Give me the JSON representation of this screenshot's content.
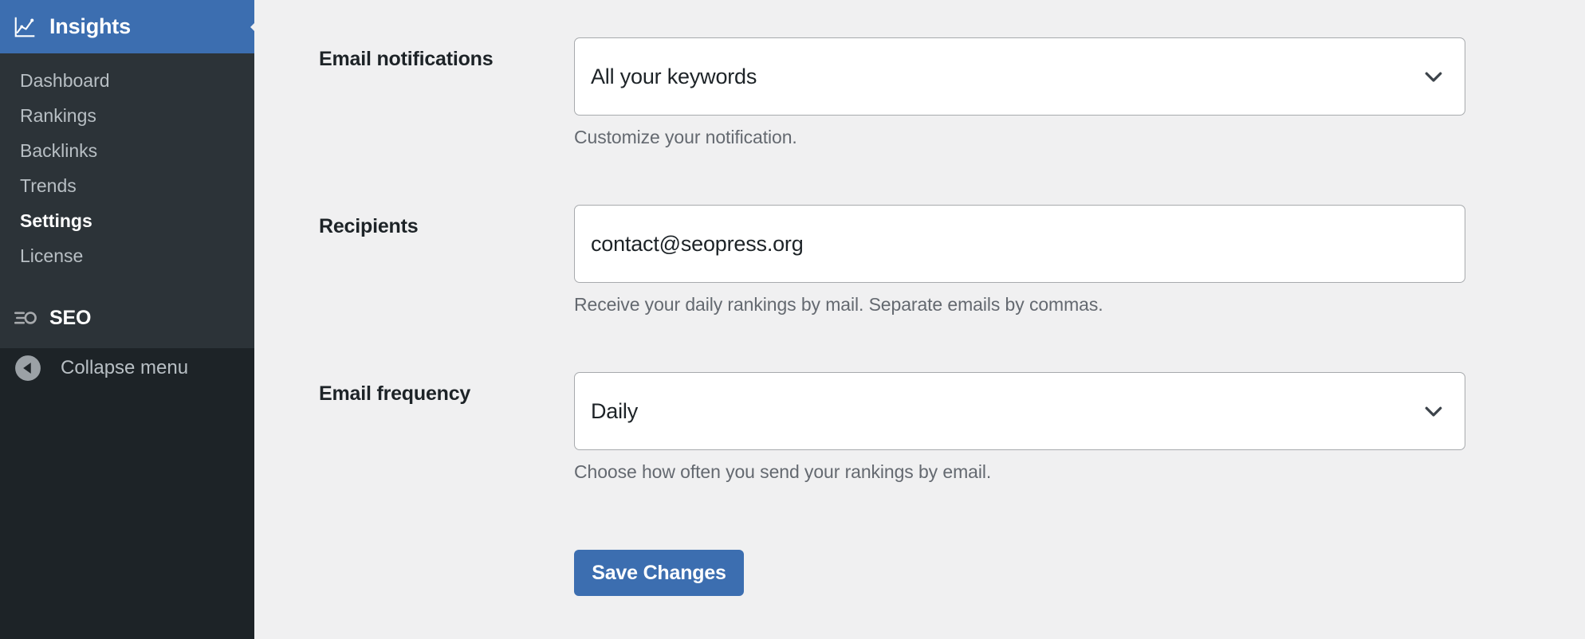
{
  "sidebar": {
    "header": {
      "label": "Insights",
      "icon": "chart-line-icon",
      "background_color": "#3c6eb0"
    },
    "items": [
      {
        "label": "Dashboard",
        "current": false
      },
      {
        "label": "Rankings",
        "current": false
      },
      {
        "label": "Backlinks",
        "current": false
      },
      {
        "label": "Trends",
        "current": false
      },
      {
        "label": "Settings",
        "current": true
      },
      {
        "label": "License",
        "current": false
      }
    ],
    "seo": {
      "label": "SEO",
      "icon": "seopress-logo-icon"
    },
    "collapse": {
      "label": "Collapse menu",
      "icon": "collapse-left-arrow-icon"
    },
    "colors": {
      "upper_background": "#2c3338",
      "lower_background": "#1d2327",
      "item_text": "#b8bfc4",
      "current_item_text": "#ffffff"
    }
  },
  "main": {
    "fields": [
      {
        "label": "Email notifications",
        "type": "select",
        "value": "All your keywords",
        "description": "Customize your notification.",
        "icon": "chevron-down-icon"
      },
      {
        "label": "Recipients",
        "type": "text",
        "value": "contact@seopress.org",
        "placeholder": "",
        "description": "Receive your daily rankings by mail. Separate emails by commas."
      },
      {
        "label": "Email frequency",
        "type": "select",
        "value": "Daily",
        "description": "Choose how often you send your rankings by email.",
        "icon": "chevron-down-icon"
      }
    ],
    "save_button": {
      "label": "Save Changes",
      "color": "#3c6eb0"
    },
    "background_color": "#f0f0f1"
  }
}
